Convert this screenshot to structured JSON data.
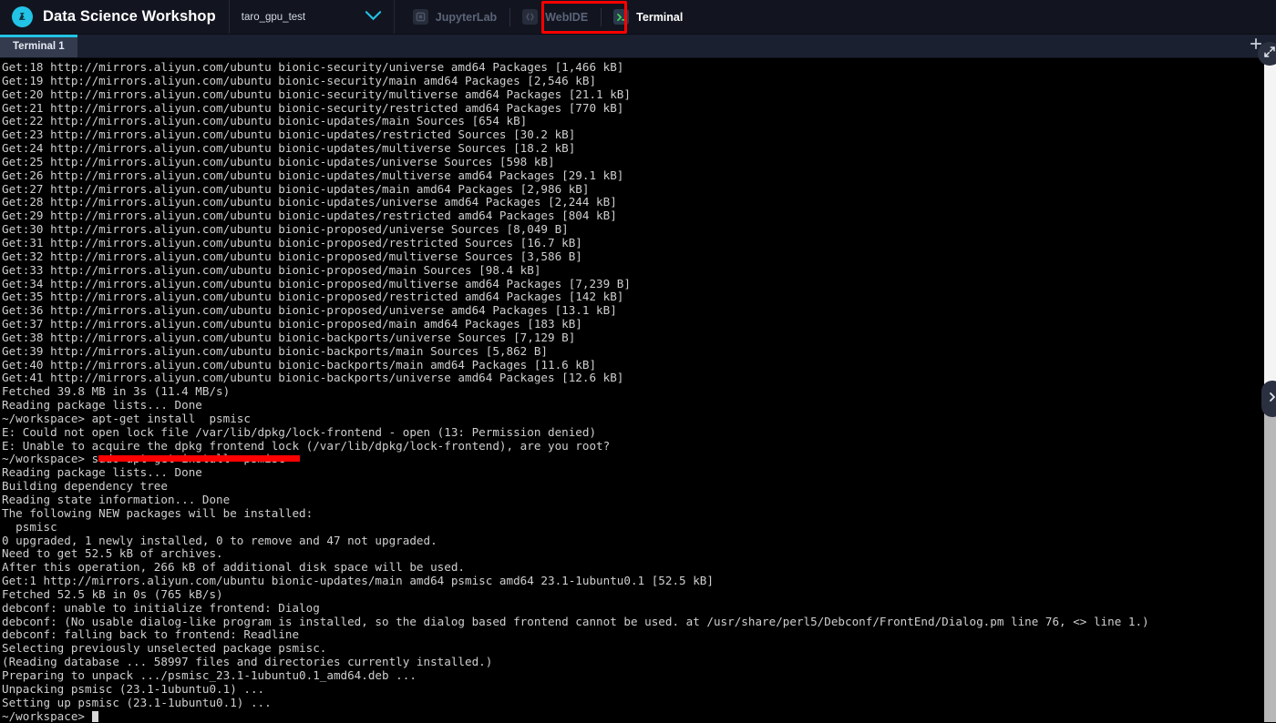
{
  "header": {
    "brand_title": "Data Science Workshop",
    "logo_icon": "workshop-logo-icon",
    "project_selector": {
      "value": "taro_gpu_test",
      "chevron_icon": "chevron-down-icon"
    },
    "app_tabs": [
      {
        "label": "JupyterLab",
        "icon": "jupyterlab-icon",
        "active": false,
        "disabled": true
      },
      {
        "label": "WebIDE",
        "icon": "webide-icon",
        "active": false,
        "disabled": true
      },
      {
        "label": "Terminal",
        "icon": "terminal-prompt-icon",
        "active": true,
        "disabled": false
      }
    ]
  },
  "tabstrip": {
    "tabs": [
      {
        "label": "Terminal 1",
        "active": true
      }
    ],
    "new_tab_label": "+",
    "new_tab_icon": "plus-icon"
  },
  "controls": {
    "expand_icon": "expand-diagonal-icon",
    "panel_toggle_icon": "chevron-right-icon",
    "scrollbar_name": "vertical-scrollbar"
  },
  "annotations": {
    "terminal_tab_highlight_color": "#ff0000",
    "sudo_command_underline_color": "#ff0000"
  },
  "colors": {
    "accent_cyan": "#22c3e6",
    "header_bg": "#121520",
    "tabstrip_bg": "#1b2030",
    "terminal_bg": "#000000",
    "terminal_fg": "#cfcfcf",
    "annotation_red": "#ff0000"
  },
  "terminal": {
    "prompt": "~/workspace>",
    "cursor_visible": true,
    "lines": [
      "Get:18 http://mirrors.aliyun.com/ubuntu bionic-security/universe amd64 Packages [1,466 kB]",
      "Get:19 http://mirrors.aliyun.com/ubuntu bionic-security/main amd64 Packages [2,546 kB]",
      "Get:20 http://mirrors.aliyun.com/ubuntu bionic-security/multiverse amd64 Packages [21.1 kB]",
      "Get:21 http://mirrors.aliyun.com/ubuntu bionic-security/restricted amd64 Packages [770 kB]",
      "Get:22 http://mirrors.aliyun.com/ubuntu bionic-updates/main Sources [654 kB]",
      "Get:23 http://mirrors.aliyun.com/ubuntu bionic-updates/restricted Sources [30.2 kB]",
      "Get:24 http://mirrors.aliyun.com/ubuntu bionic-updates/multiverse Sources [18.2 kB]",
      "Get:25 http://mirrors.aliyun.com/ubuntu bionic-updates/universe Sources [598 kB]",
      "Get:26 http://mirrors.aliyun.com/ubuntu bionic-updates/multiverse amd64 Packages [29.1 kB]",
      "Get:27 http://mirrors.aliyun.com/ubuntu bionic-updates/main amd64 Packages [2,986 kB]",
      "Get:28 http://mirrors.aliyun.com/ubuntu bionic-updates/universe amd64 Packages [2,244 kB]",
      "Get:29 http://mirrors.aliyun.com/ubuntu bionic-updates/restricted amd64 Packages [804 kB]",
      "Get:30 http://mirrors.aliyun.com/ubuntu bionic-proposed/universe Sources [8,049 B]",
      "Get:31 http://mirrors.aliyun.com/ubuntu bionic-proposed/restricted Sources [16.7 kB]",
      "Get:32 http://mirrors.aliyun.com/ubuntu bionic-proposed/multiverse Sources [3,586 B]",
      "Get:33 http://mirrors.aliyun.com/ubuntu bionic-proposed/main Sources [98.4 kB]",
      "Get:34 http://mirrors.aliyun.com/ubuntu bionic-proposed/multiverse amd64 Packages [7,239 B]",
      "Get:35 http://mirrors.aliyun.com/ubuntu bionic-proposed/restricted amd64 Packages [142 kB]",
      "Get:36 http://mirrors.aliyun.com/ubuntu bionic-proposed/universe amd64 Packages [13.1 kB]",
      "Get:37 http://mirrors.aliyun.com/ubuntu bionic-proposed/main amd64 Packages [183 kB]",
      "Get:38 http://mirrors.aliyun.com/ubuntu bionic-backports/universe Sources [7,129 B]",
      "Get:39 http://mirrors.aliyun.com/ubuntu bionic-backports/main Sources [5,862 B]",
      "Get:40 http://mirrors.aliyun.com/ubuntu bionic-backports/main amd64 Packages [11.6 kB]",
      "Get:41 http://mirrors.aliyun.com/ubuntu bionic-backports/universe amd64 Packages [12.6 kB]",
      "Fetched 39.8 MB in 3s (11.4 MB/s)",
      "Reading package lists... Done",
      "~/workspace> apt-get install  psmisc",
      "E: Could not open lock file /var/lib/dpkg/lock-frontend - open (13: Permission denied)",
      "E: Unable to acquire the dpkg frontend lock (/var/lib/dpkg/lock-frontend), are you root?",
      "~/workspace> sudo apt-get install  psmisc",
      "Reading package lists... Done",
      "Building dependency tree",
      "Reading state information... Done",
      "The following NEW packages will be installed:",
      "  psmisc",
      "0 upgraded, 1 newly installed, 0 to remove and 47 not upgraded.",
      "Need to get 52.5 kB of archives.",
      "After this operation, 266 kB of additional disk space will be used.",
      "Get:1 http://mirrors.aliyun.com/ubuntu bionic-updates/main amd64 psmisc amd64 23.1-1ubuntu0.1 [52.5 kB]",
      "Fetched 52.5 kB in 0s (765 kB/s)",
      "debconf: unable to initialize frontend: Dialog",
      "debconf: (No usable dialog-like program is installed, so the dialog based frontend cannot be used. at /usr/share/perl5/Debconf/FrontEnd/Dialog.pm line 76, <> line 1.)",
      "debconf: falling back to frontend: Readline",
      "Selecting previously unselected package psmisc.",
      "(Reading database ... 58997 files and directories currently installed.)",
      "Preparing to unpack .../psmisc_23.1-1ubuntu0.1_amd64.deb ...",
      "Unpacking psmisc (23.1-1ubuntu0.1) ...",
      "Setting up psmisc (23.1-1ubuntu0.1) ..."
    ]
  }
}
